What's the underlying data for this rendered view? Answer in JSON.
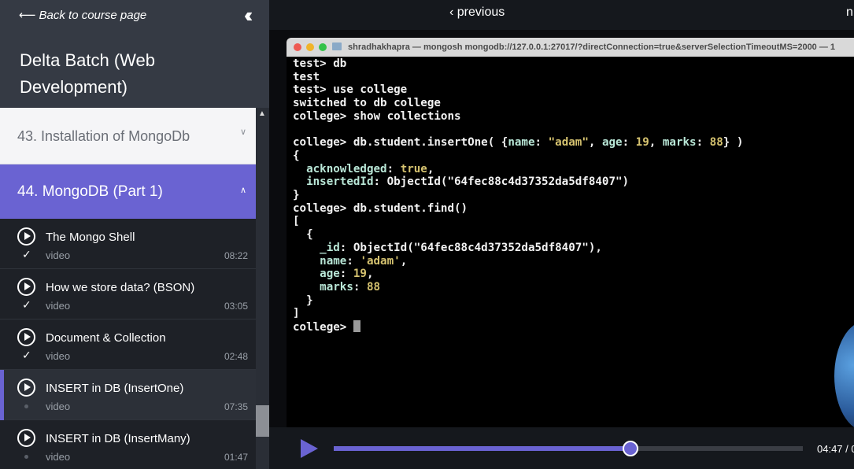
{
  "sidebar": {
    "back_label": "Back to course page",
    "course_title": "Delta Batch (Web Development)",
    "sections": [
      {
        "label": "43. Installation of MongoDb",
        "expanded": false
      },
      {
        "label": "44. MongoDB (Part 1)",
        "expanded": true
      }
    ],
    "lessons": [
      {
        "title": "The Mongo Shell",
        "type": "video",
        "duration": "08:22",
        "completed": true,
        "active": false
      },
      {
        "title": "How we store data? (BSON)",
        "type": "video",
        "duration": "03:05",
        "completed": true,
        "active": false
      },
      {
        "title": "Document & Collection",
        "type": "video",
        "duration": "02:48",
        "completed": true,
        "active": false
      },
      {
        "title": "INSERT in DB (InsertOne)",
        "type": "video",
        "duration": "07:35",
        "completed": false,
        "active": true
      },
      {
        "title": "INSERT in DB (InsertMany)",
        "type": "video",
        "duration": "01:47",
        "completed": false,
        "active": false
      }
    ]
  },
  "topbar": {
    "previous_label": "previous",
    "next_label": "n"
  },
  "terminal": {
    "window_title": "shradhakhapra — mongosh mongodb://127.0.0.1:27017/?directConnection=true&serverSelectionTimeoutMS=2000 — 1",
    "prompt_final": "college> "
  },
  "player": {
    "time_display": "04:47 / 0",
    "progress": 0.633
  },
  "colors": {
    "accent": "#6a63d2",
    "sidebar_bg": "#2a2e36",
    "terminal_bg": "#000000"
  }
}
